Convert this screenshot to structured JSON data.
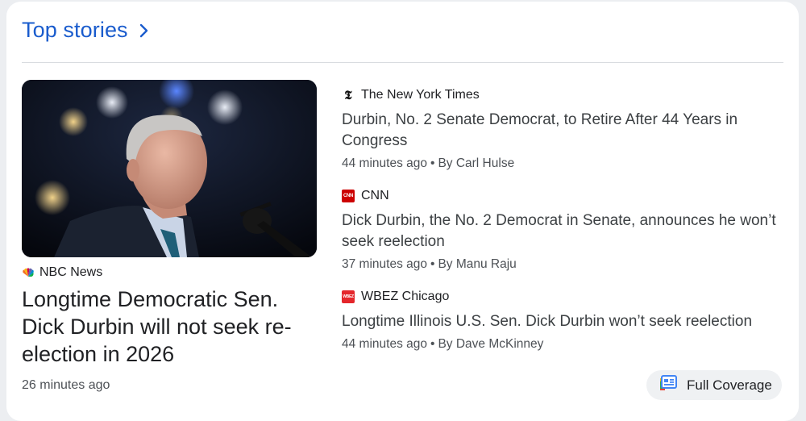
{
  "header": {
    "title": "Top stories"
  },
  "lead": {
    "source": "NBC News",
    "title": "Longtime Democratic Sen. Dick Durbin will not seek re-election in 2026",
    "time": "26 minutes ago"
  },
  "stories": [
    {
      "source": "The New York Times",
      "favicon": "nyt-logo-icon",
      "title": "Durbin, No. 2 Senate Democrat, to Retire After 44 Years in Congress",
      "time": "44 minutes ago",
      "author": "By Carl Hulse"
    },
    {
      "source": "CNN",
      "favicon": "cnn-logo-icon",
      "favicon_text": "CNN",
      "favicon_color": "#cc0000",
      "title": "Dick Durbin, the No. 2 Democrat in Senate, announces he won’t seek reelection",
      "time": "37 minutes ago",
      "author": "By Manu Raju"
    },
    {
      "source": "WBEZ Chicago",
      "favicon": "wbez-logo-icon",
      "favicon_text": "WBEZ",
      "favicon_color": "#e4262b",
      "title": "Longtime Illinois U.S. Sen. Dick Durbin won’t seek reelection",
      "time": "44 minutes ago",
      "author": "By Dave McKinney"
    }
  ],
  "full_coverage": {
    "label": "Full Coverage"
  },
  "separator": "•",
  "colors": {
    "link_blue": "#1a5ccd",
    "card_bg": "#ffffff",
    "page_bg": "#eceef1"
  }
}
